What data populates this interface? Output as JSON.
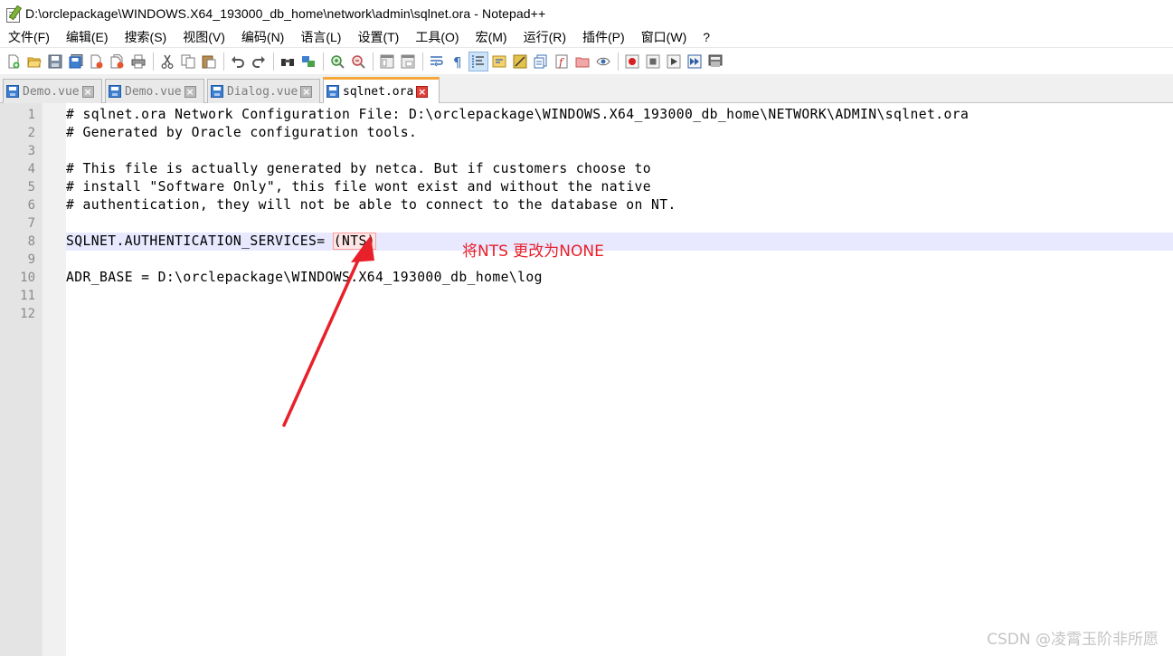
{
  "window": {
    "title": "D:\\orclepackage\\WINDOWS.X64_193000_db_home\\network\\admin\\sqlnet.ora - Notepad++"
  },
  "menu": [
    "文件(F)",
    "编辑(E)",
    "搜索(S)",
    "视图(V)",
    "编码(N)",
    "语言(L)",
    "设置(T)",
    "工具(O)",
    "宏(M)",
    "运行(R)",
    "插件(P)",
    "窗口(W)",
    "?"
  ],
  "tabs": [
    {
      "label": "Demo.vue",
      "active": false
    },
    {
      "label": "Demo.vue",
      "active": false
    },
    {
      "label": "Dialog.vue",
      "active": false
    },
    {
      "label": "sqlnet.ora",
      "active": true
    }
  ],
  "editor": {
    "line_numbers": [
      "1",
      "2",
      "3",
      "4",
      "5",
      "6",
      "7",
      "8",
      "9",
      "10",
      "11",
      "12"
    ],
    "lines": [
      "# sqlnet.ora Network Configuration File: D:\\orclepackage\\WINDOWS.X64_193000_db_home\\NETWORK\\ADMIN\\sqlnet.ora",
      "# Generated by Oracle configuration tools.",
      "",
      "# This file is actually generated by netca. But if customers choose to",
      "# install \"Software Only\", this file wont exist and without the native",
      "# authentication, they will not be able to connect to the database on NT.",
      "",
      "SQLNET.AUTHENTICATION_SERVICES= ",
      "",
      "ADR_BASE = D:\\orclepackage\\WINDOWS.X64_193000_db_home\\log",
      "",
      ""
    ],
    "line8_value": "(NTS)",
    "current_line": 8
  },
  "annotation": {
    "text": "将NTS 更改为NONE",
    "color": "#e8202a"
  },
  "watermark": "CSDN @凌霄玉阶非所愿",
  "colors": {
    "current_line_bg": "#e8e8ff",
    "gutter_bg": "#e4e4e4",
    "active_tab_accent": "#f6a83b"
  }
}
